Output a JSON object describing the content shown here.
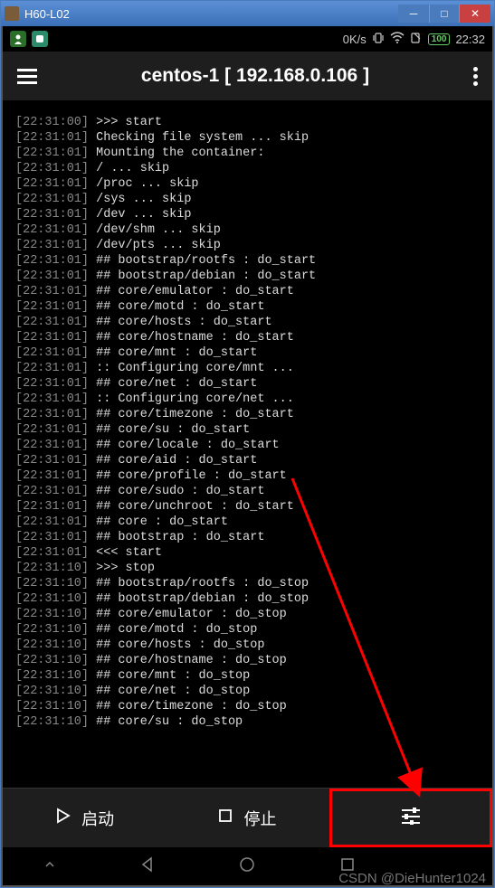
{
  "window": {
    "title": "H60-L02"
  },
  "statusbar": {
    "speed": "0K/s",
    "battery": "100",
    "time": "22:32"
  },
  "header": {
    "title": "centos-1  [ 192.168.0.106 ]"
  },
  "terminal": {
    "lines": [
      {
        "ts": "[22:31:00]",
        "txt": " >>> start"
      },
      {
        "ts": "[22:31:01]",
        "txt": " Checking file system ... skip"
      },
      {
        "ts": "[22:31:01]",
        "txt": " Mounting the container:"
      },
      {
        "ts": "[22:31:01]",
        "txt": " / ... skip"
      },
      {
        "ts": "[22:31:01]",
        "txt": " /proc ... skip"
      },
      {
        "ts": "[22:31:01]",
        "txt": " /sys ... skip"
      },
      {
        "ts": "[22:31:01]",
        "txt": " /dev ... skip"
      },
      {
        "ts": "[22:31:01]",
        "txt": " /dev/shm ... skip"
      },
      {
        "ts": "[22:31:01]",
        "txt": " /dev/pts ... skip"
      },
      {
        "ts": "[22:31:01]",
        "txt": " ## bootstrap/rootfs : do_start"
      },
      {
        "ts": "[22:31:01]",
        "txt": " ## bootstrap/debian : do_start"
      },
      {
        "ts": "[22:31:01]",
        "txt": " ## core/emulator : do_start"
      },
      {
        "ts": "[22:31:01]",
        "txt": " ## core/motd : do_start"
      },
      {
        "ts": "[22:31:01]",
        "txt": " ## core/hosts : do_start"
      },
      {
        "ts": "[22:31:01]",
        "txt": " ## core/hostname : do_start"
      },
      {
        "ts": "[22:31:01]",
        "txt": " ## core/mnt : do_start"
      },
      {
        "ts": "[22:31:01]",
        "txt": " :: Configuring core/mnt ..."
      },
      {
        "ts": "[22:31:01]",
        "txt": " ## core/net : do_start"
      },
      {
        "ts": "[22:31:01]",
        "txt": " :: Configuring core/net ..."
      },
      {
        "ts": "[22:31:01]",
        "txt": " ## core/timezone : do_start"
      },
      {
        "ts": "[22:31:01]",
        "txt": " ## core/su : do_start"
      },
      {
        "ts": "[22:31:01]",
        "txt": " ## core/locale : do_start"
      },
      {
        "ts": "[22:31:01]",
        "txt": " ## core/aid : do_start"
      },
      {
        "ts": "[22:31:01]",
        "txt": " ## core/profile : do_start"
      },
      {
        "ts": "[22:31:01]",
        "txt": " ## core/sudo : do_start"
      },
      {
        "ts": "[22:31:01]",
        "txt": " ## core/unchroot : do_start"
      },
      {
        "ts": "[22:31:01]",
        "txt": " ## core : do_start"
      },
      {
        "ts": "[22:31:01]",
        "txt": " ## bootstrap : do_start"
      },
      {
        "ts": "[22:31:01]",
        "txt": " <<< start"
      },
      {
        "ts": "[22:31:10]",
        "txt": " >>> stop"
      },
      {
        "ts": "[22:31:10]",
        "txt": " ## bootstrap/rootfs : do_stop"
      },
      {
        "ts": "[22:31:10]",
        "txt": " ## bootstrap/debian : do_stop"
      },
      {
        "ts": "[22:31:10]",
        "txt": " ## core/emulator : do_stop"
      },
      {
        "ts": "[22:31:10]",
        "txt": " ## core/motd : do_stop"
      },
      {
        "ts": "[22:31:10]",
        "txt": " ## core/hosts : do_stop"
      },
      {
        "ts": "[22:31:10]",
        "txt": " ## core/hostname : do_stop"
      },
      {
        "ts": "[22:31:10]",
        "txt": " ## core/mnt : do_stop"
      },
      {
        "ts": "[22:31:10]",
        "txt": " ## core/net : do_stop"
      },
      {
        "ts": "[22:31:10]",
        "txt": " ## core/timezone : do_stop"
      },
      {
        "ts": "[22:31:10]",
        "txt": " ## core/su : do_stop"
      }
    ]
  },
  "bottom": {
    "start_label": "启动",
    "stop_label": "停止"
  },
  "watermark": "CSDN @DieHunter1024"
}
